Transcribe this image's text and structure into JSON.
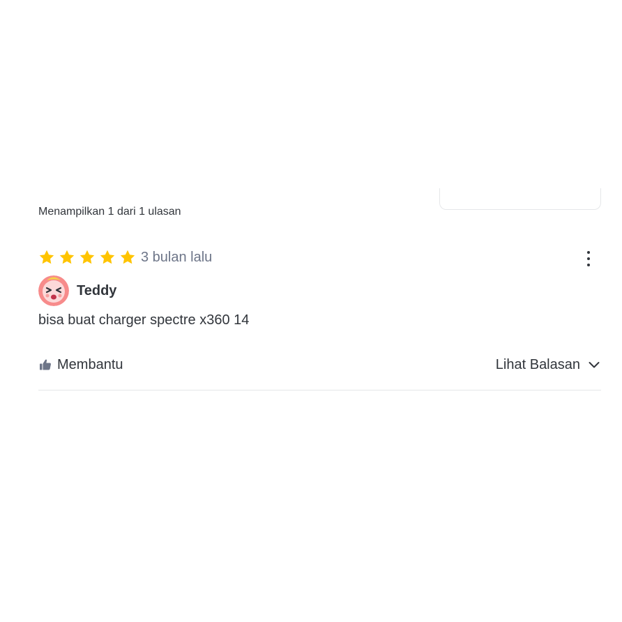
{
  "summary": {
    "count_text": "Menampilkan 1 dari 1 ulasan"
  },
  "review": {
    "rating": 5,
    "max_rating": 5,
    "time": "3 bulan lalu",
    "user": {
      "name": "Teddy",
      "avatar_icon": "laughing-face-avatar"
    },
    "text": "bisa buat charger spectre x360 14",
    "menu_icon": "more-vertical-icon"
  },
  "actions": {
    "helpful_label": "Membantu",
    "helpful_icon": "thumbs-up-icon",
    "replies_label": "Lihat Balasan",
    "replies_icon": "chevron-down-icon"
  },
  "colors": {
    "star": "#ffc400",
    "text": "#31353b",
    "muted_text": "#6d7588",
    "divider": "#e5e7e9"
  }
}
